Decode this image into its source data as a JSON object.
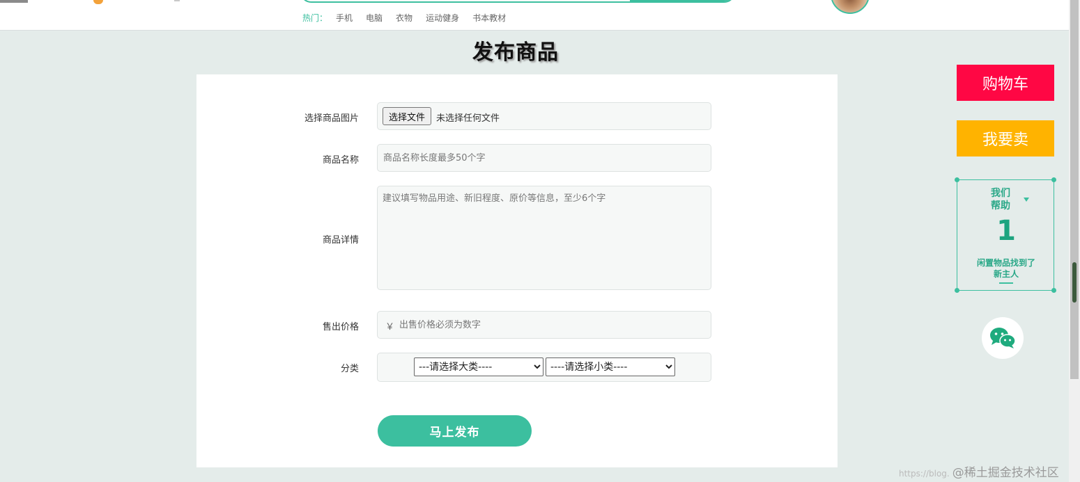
{
  "header": {
    "hot_label": "热门：",
    "hot_items": [
      "手机",
      "电脑",
      "衣物",
      "运动健身",
      "书本教材"
    ]
  },
  "page": {
    "title": "发布商品"
  },
  "form": {
    "image": {
      "label": "选择商品图片",
      "button": "选择文件",
      "status": "未选择任何文件"
    },
    "name": {
      "label": "商品名称",
      "placeholder": "商品名称长度最多50个字",
      "value": ""
    },
    "detail": {
      "label": "商品详情",
      "placeholder": "建议填写物品用途、新旧程度、原价等信息，至少6个字",
      "value": ""
    },
    "price": {
      "label": "售出价格",
      "currency": "￥",
      "placeholder": "出售价格必须为数字",
      "value": ""
    },
    "category": {
      "label": "分类",
      "major_selected": "---请选择大类----",
      "minor_selected": "----请选择小类----"
    },
    "submit_label": "马上发布"
  },
  "sidebar": {
    "cart_label": "购物车",
    "sell_label": "我要卖",
    "help": {
      "title_line1": "我们",
      "title_line2": "帮助",
      "count": "1",
      "desc_line1": "闲置物品找到了",
      "desc_line2": "新主人"
    }
  },
  "watermark": {
    "url": "https://blog.",
    "text": "@稀土掘金技术社区"
  },
  "colors": {
    "accent": "#3cbf9f",
    "cart": "#ff0744",
    "sell": "#ffb300",
    "background": "#e4ecea"
  }
}
